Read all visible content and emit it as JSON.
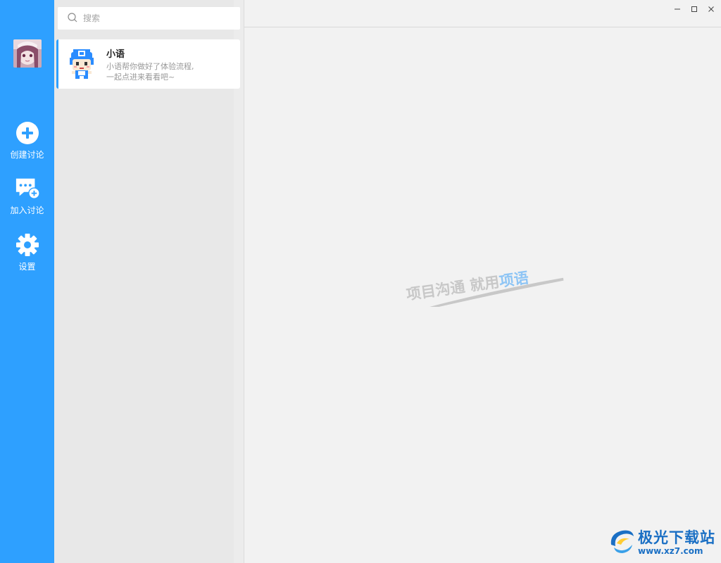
{
  "nav": {
    "items": [
      {
        "label": "创建讨论",
        "icon": "plus-circle-icon"
      },
      {
        "label": "加入讨论",
        "icon": "chat-add-icon"
      },
      {
        "label": "设置",
        "icon": "gear-icon"
      }
    ],
    "color": "#2ea0ff"
  },
  "search": {
    "placeholder": "搜索"
  },
  "conversations": [
    {
      "title": "小语",
      "preview_line1": "小语帮你做好了体验流程,",
      "preview_line2": "一起点进来看看吧~"
    }
  ],
  "main": {
    "slogan_part1": "项目沟通 就用",
    "slogan_part2": "项语",
    "window_controls": [
      "minimize",
      "maximize",
      "close"
    ]
  },
  "watermark": {
    "name": "极光下载站",
    "url": "www.xz7.com"
  }
}
